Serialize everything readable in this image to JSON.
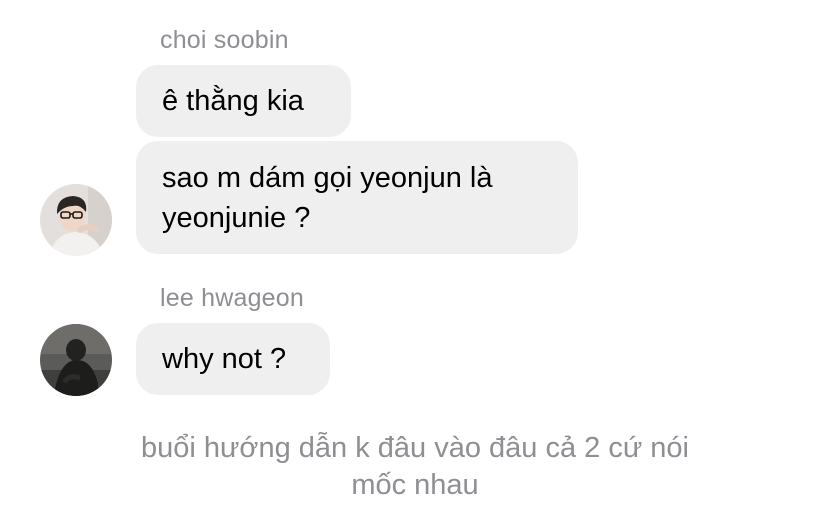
{
  "messages": [
    {
      "sender": "choi soobin",
      "bubbles": [
        "ê thằng kia",
        "sao m dám gọi yeonjun là yeonjunie ?"
      ],
      "bubble_lines": [
        "sao m dám gọi yeonjun là",
        "yeonjunie ?"
      ]
    },
    {
      "sender": "lee hwageon",
      "bubbles": [
        "why not ?"
      ]
    }
  ],
  "caption": {
    "line1": "buổi hướng dẫn k đâu vào đâu cả 2 cứ nói",
    "line2": "mốc nhau"
  },
  "colors": {
    "bubble_bg": "#efefef",
    "meta_text": "#8e8e93",
    "message_text": "#000000"
  }
}
